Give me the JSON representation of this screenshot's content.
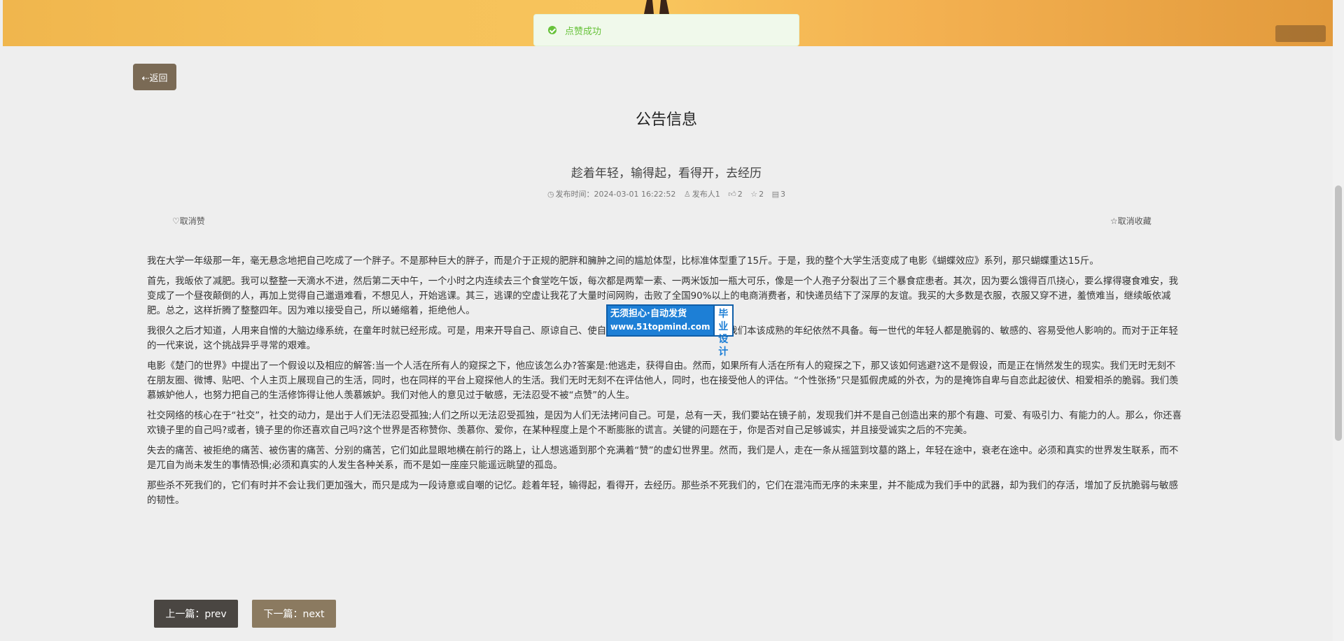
{
  "colors": {
    "background": "#eeeeee",
    "banner": "#f6c25a",
    "back_button": "#7a6a55",
    "prev_button": "#4a4642",
    "next_button": "#8b7a60",
    "toast_text": "#67c23a"
  },
  "toast": {
    "message": "点赞成功"
  },
  "back_button": {
    "label": "⇠返回"
  },
  "page_title": "公告信息",
  "article": {
    "title": "趁着年轻，输得起，看得开，去经历",
    "meta": {
      "publish_time": "发布时间：2024-03-01 16:22:52",
      "publisher": "发布人1",
      "likes": "2",
      "favorites": "2",
      "comments": "3"
    },
    "unlike_label": "取消赞",
    "unfavorite_label": "取消收藏",
    "paragraphs": [
      "我在大学一年级那一年，毫无悬念地把自己吃成了一个胖子。不是那种巨大的胖子，而是介于正规的肥胖和臃肿之间的尴尬体型，比标准体型重了15斤。于是，我的整个大学生活变成了电影《蝴蝶效应》系列，那只蝴蝶重达15斤。",
      "首先，我皈依了减肥。我可以整整一天滴水不进，然后第二天中午，一个小时之内连续去三个食堂吃午饭，每次都是两荤一素、一两米饭加一瓶大可乐，像是一个人孢子分裂出了三个暴食症患者。其次，因为要么饿得百爪挠心，要么撑得寝食难安，我变成了一个昼夜颠倒的人，再加上觉得自己邋遢难看，不想见人，开始逃课。其三，逃课的空虚让我花了大量时间网购，击败了全国90%以上的电商消费者，和快递员结下了深厚的友谊。我买的大多数是衣服，衣服又穿不进，羞愤难当，继续皈依减肥。总之，这样折腾了整整四年。因为难以接受自己，所以蜷缩着，拒绝他人。",
      "我很久之后才知道，人用来自憎的大脑边缘系统，在童年时就已经形成。可是，用来开导自己、原谅自己、使自己变得强大的智慧，却往往在我们本该成熟的年纪依然不具备。每一世代的年轻人都是脆弱的、敏感的、容易受他人影响的。而对于正年轻的一代来说，这个挑战异乎寻常的艰难。",
      "电影《楚门的世界》中提出了一个假设以及相应的解答:当一个人活在所有人的窥探之下，他应该怎么办?答案是:他逃走，获得自由。然而，如果所有人活在所有人的窥探之下，那又该如何逃避?这不是假设，而是正在悄然发生的现实。我们无时无刻不在朋友圈、微博、贴吧、个人主页上展现自己的生活，同时，也在同样的平台上窥探他人的生活。我们无时无刻不在评估他人，同时，也在接受他人的评估。“个性张扬”只是狐假虎威的外衣，为的是掩饰自卑与自恋此起彼伏、相爱相杀的脆弱。我们羡慕嫉妒他人，也努力把自己的生活修饰得让他人羡慕嫉妒。我们对他人的意见过于敏感，无法忍受不被“点赞”的人生。",
      "社交网络的核心在于“社交”，社交的动力，是出于人们无法忍受孤独;人们之所以无法忍受孤独，是因为人们无法拷问自己。可是，总有一天，我们要站在镜子前，发现我们并不是自己创造出来的那个有趣、可爱、有吸引力、有能力的人。那么，你还喜欢镜子里的自己吗?或者，镜子里的你还喜欢自己吗?这个世界是否称赞你、羡慕你、爱你，在某种程度上是个不断膨胀的谎言。关键的问题在于，你是否对自己足够诚实，并且接受诚实之后的不完美。",
      "失去的痛苦、被拒绝的痛苦、被伤害的痛苦、分别的痛苦，它们如此显眼地横在前行的路上，让人想逃遁到那个充满着“赞”的虚幻世界里。然而，我们是人，走在一条从摇篮到坟墓的路上，年轻在途中，衰老在途中。必须和真实的世界发生联系，而不是兀自为尚未发生的事情恐惧;必须和真实的人发生各种关系，而不是如一座座只能遥远眺望的孤岛。",
      "那些杀不死我们的，它们有时并不会让我们更加强大，而只是成为一段诗意或自嘲的记忆。趁着年轻，输得起，看得开，去经历。那些杀不死我们的，它们在混沌而无序的未来里，并不能成为我们手中的武器，却为我们的存活，增加了反抗脆弱与敏感的韧性。"
    ]
  },
  "ad_badge": {
    "line1": "无须担心·自动发货",
    "url": "www.51topmind.com",
    "side": "毕业设计"
  },
  "pagination": {
    "prev_label": "上一篇：prev",
    "next_label": "下一篇：next"
  }
}
